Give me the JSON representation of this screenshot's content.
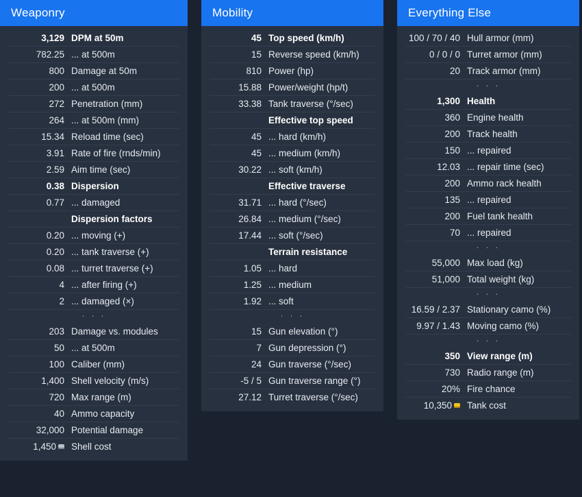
{
  "theme": {
    "background": "#1a2230",
    "panel_bg": "#28313f",
    "header_bg": "#1874ef",
    "header_text": "#ffffff",
    "text": "#e7ebf2",
    "separator": "#333d4d",
    "gold": "#f2c01e",
    "silver": "#b8c0cc"
  },
  "panels": [
    {
      "title": "Weaponry",
      "rows": [
        {
          "value": "3,129",
          "label": "DPM at 50m",
          "style": "bold"
        },
        {
          "value": "782.25",
          "label": "... at 500m",
          "style": "normal"
        },
        {
          "value": "800",
          "label": "Damage at 50m",
          "style": "normal"
        },
        {
          "value": "200",
          "label": "... at 500m",
          "style": "normal"
        },
        {
          "value": "272",
          "label": "Penetration (mm)",
          "style": "normal"
        },
        {
          "value": "264",
          "label": "... at 500m (mm)",
          "style": "normal"
        },
        {
          "value": "15.34",
          "label": "Reload time (sec)",
          "style": "normal"
        },
        {
          "value": "3.91",
          "label": "Rate of fire (rnds/min)",
          "style": "normal"
        },
        {
          "value": "2.59",
          "label": "Aim time (sec)",
          "style": "normal"
        },
        {
          "value": "0.38",
          "label": "Dispersion",
          "style": "bold"
        },
        {
          "value": "0.77",
          "label": "... damaged",
          "style": "normal"
        },
        {
          "value": "",
          "label": "Dispersion factors",
          "style": "heading"
        },
        {
          "value": "0.20",
          "label": "... moving (+)",
          "style": "normal"
        },
        {
          "value": "0.20",
          "label": "... tank traverse (+)",
          "style": "normal"
        },
        {
          "value": "0.08",
          "label": "... turret traverse (+)",
          "style": "normal"
        },
        {
          "value": "4",
          "label": "... after firing (+)",
          "style": "normal"
        },
        {
          "value": "2",
          "label": "... damaged (×)",
          "style": "normal"
        },
        {
          "value": "",
          "label": "",
          "style": "dots",
          "dots": "· · ·"
        },
        {
          "value": "203",
          "label": "Damage vs. modules",
          "style": "normal"
        },
        {
          "value": "50",
          "label": "... at 500m",
          "style": "normal"
        },
        {
          "value": "100",
          "label": "Caliber (mm)",
          "style": "normal"
        },
        {
          "value": "1,400",
          "label": "Shell velocity (m/s)",
          "style": "normal"
        },
        {
          "value": "720",
          "label": "Max range (m)",
          "style": "normal"
        },
        {
          "value": "40",
          "label": "Ammo capacity",
          "style": "normal"
        },
        {
          "value": "32,000",
          "label": "Potential damage",
          "style": "normal"
        },
        {
          "value": "1,450",
          "label": "Shell cost",
          "style": "normal",
          "coin": "silver"
        }
      ]
    },
    {
      "title": "Mobility",
      "rows": [
        {
          "value": "45",
          "label": "Top speed (km/h)",
          "style": "bold"
        },
        {
          "value": "15",
          "label": "Reverse speed (km/h)",
          "style": "normal"
        },
        {
          "value": "810",
          "label": "Power (hp)",
          "style": "normal"
        },
        {
          "value": "15.88",
          "label": "Power/weight (hp/t)",
          "style": "normal"
        },
        {
          "value": "33.38",
          "label": "Tank traverse (°/sec)",
          "style": "normal"
        },
        {
          "value": "",
          "label": "Effective top speed",
          "style": "heading"
        },
        {
          "value": "45",
          "label": "... hard (km/h)",
          "style": "normal"
        },
        {
          "value": "45",
          "label": "... medium (km/h)",
          "style": "normal"
        },
        {
          "value": "30.22",
          "label": "... soft (km/h)",
          "style": "normal"
        },
        {
          "value": "",
          "label": "Effective traverse",
          "style": "heading"
        },
        {
          "value": "31.71",
          "label": "... hard (°/sec)",
          "style": "normal"
        },
        {
          "value": "26.84",
          "label": "... medium (°/sec)",
          "style": "normal"
        },
        {
          "value": "17.44",
          "label": "... soft (°/sec)",
          "style": "normal"
        },
        {
          "value": "",
          "label": "Terrain resistance",
          "style": "heading"
        },
        {
          "value": "1.05",
          "label": "... hard",
          "style": "normal"
        },
        {
          "value": "1.25",
          "label": "... medium",
          "style": "normal"
        },
        {
          "value": "1.92",
          "label": "... soft",
          "style": "normal"
        },
        {
          "value": "",
          "label": "",
          "style": "dots",
          "dots": "· · ·"
        },
        {
          "value": "15",
          "label": "Gun elevation (°)",
          "style": "normal"
        },
        {
          "value": "7",
          "label": "Gun depression (°)",
          "style": "normal"
        },
        {
          "value": "24",
          "label": "Gun traverse (°/sec)",
          "style": "normal"
        },
        {
          "value": "-5 / 5",
          "label": "Gun traverse range (°)",
          "style": "normal"
        },
        {
          "value": "27.12",
          "label": "Turret traverse (°/sec)",
          "style": "normal"
        }
      ]
    },
    {
      "title": "Everything Else",
      "rows": [
        {
          "value": "100 / 70 / 40",
          "label": "Hull armor (mm)",
          "style": "normal"
        },
        {
          "value": "0 / 0 / 0",
          "label": "Turret armor (mm)",
          "style": "normal"
        },
        {
          "value": "20",
          "label": "Track armor (mm)",
          "style": "normal"
        },
        {
          "value": "",
          "label": "",
          "style": "dots",
          "dots": "· · ·"
        },
        {
          "value": "1,300",
          "label": "Health",
          "style": "bold"
        },
        {
          "value": "360",
          "label": "Engine health",
          "style": "normal"
        },
        {
          "value": "200",
          "label": "Track health",
          "style": "normal"
        },
        {
          "value": "150",
          "label": "... repaired",
          "style": "normal"
        },
        {
          "value": "12.03",
          "label": "... repair time (sec)",
          "style": "normal"
        },
        {
          "value": "200",
          "label": "Ammo rack health",
          "style": "normal"
        },
        {
          "value": "135",
          "label": "... repaired",
          "style": "normal"
        },
        {
          "value": "200",
          "label": "Fuel tank health",
          "style": "normal"
        },
        {
          "value": "70",
          "label": "... repaired",
          "style": "normal"
        },
        {
          "value": "",
          "label": "",
          "style": "dots",
          "dots": "· · ·"
        },
        {
          "value": "55,000",
          "label": "Max load (kg)",
          "style": "normal"
        },
        {
          "value": "51,000",
          "label": "Total weight (kg)",
          "style": "normal"
        },
        {
          "value": "",
          "label": "",
          "style": "dots",
          "dots": "· · ·"
        },
        {
          "value": "16.59 / 2.37",
          "label": "Stationary camo (%)",
          "style": "normal"
        },
        {
          "value": "9.97 / 1.43",
          "label": "Moving camo (%)",
          "style": "normal"
        },
        {
          "value": "",
          "label": "",
          "style": "dots",
          "dots": "· · ·"
        },
        {
          "value": "350",
          "label": "View range (m)",
          "style": "bold"
        },
        {
          "value": "730",
          "label": "Radio range (m)",
          "style": "normal"
        },
        {
          "value": "20%",
          "label": "Fire chance",
          "style": "normal"
        },
        {
          "value": "10,350",
          "label": "Tank cost",
          "style": "normal",
          "coin": "gold"
        }
      ]
    }
  ]
}
